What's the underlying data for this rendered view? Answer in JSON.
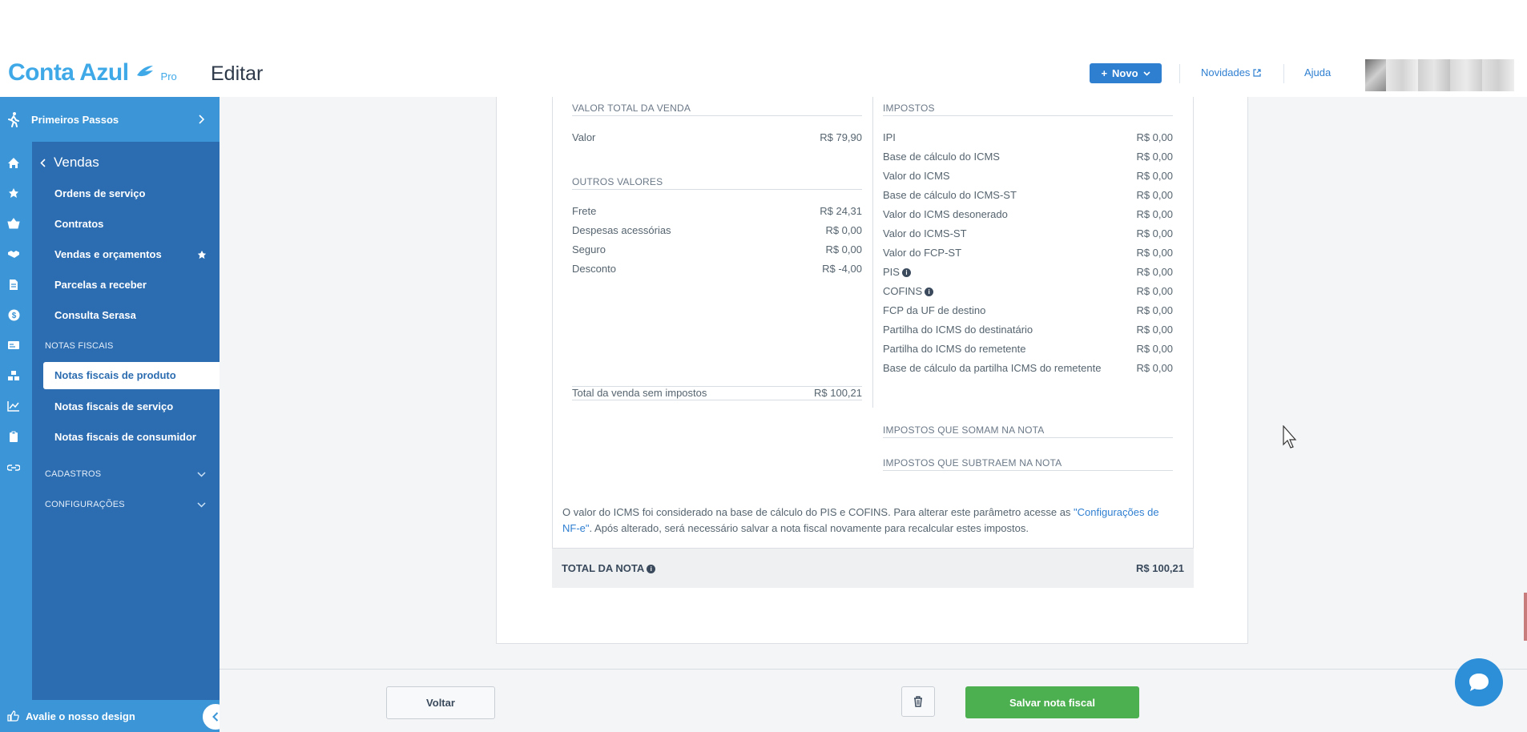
{
  "header": {
    "logo_text": "Conta Azul",
    "logo_pro": "Pro",
    "title": "Editar",
    "novo_label": "Novo",
    "links": [
      "Novidades",
      "Ajuda"
    ]
  },
  "sidebar": {
    "primeiros_passos": "Primeiros Passos",
    "section_title": "Vendas",
    "items": [
      {
        "label": "Ordens de serviço"
      },
      {
        "label": "Contratos"
      },
      {
        "label": "Vendas e orçamentos"
      },
      {
        "label": "Parcelas a receber"
      },
      {
        "label": "Consulta Serasa"
      }
    ],
    "notas_heading": "NOTAS FISCAIS",
    "notas_items": [
      {
        "label": "Notas fiscais de produto"
      },
      {
        "label": "Notas fiscais de serviço"
      },
      {
        "label": "Notas fiscais de consumidor"
      }
    ],
    "cadastros": "CADASTROS",
    "configuracoes": "CONFIGURAÇÕES",
    "footer": "Avalie o nosso design"
  },
  "summary": {
    "valor_total_title": "VALOR TOTAL DA VENDA",
    "valor_label": "Valor",
    "valor_value": "R$ 79,90",
    "outros_title": "OUTROS VALORES",
    "outros": [
      {
        "label": "Frete",
        "value": "R$ 24,31"
      },
      {
        "label": "Despesas acessórias",
        "value": "R$ 0,00"
      },
      {
        "label": "Seguro",
        "value": "R$ 0,00"
      },
      {
        "label": "Desconto",
        "value": "R$ -4,00"
      }
    ],
    "total_sem_label": "Total da venda sem impostos",
    "total_sem_value": "R$ 100,21",
    "impostos_title": "IMPOSTOS",
    "impostos": [
      {
        "label": "IPI",
        "value": "R$ 0,00"
      },
      {
        "label": "Base de cálculo do ICMS",
        "value": "R$ 0,00"
      },
      {
        "label": "Valor do ICMS",
        "value": "R$ 0,00"
      },
      {
        "label": "Base de cálculo do ICMS-ST",
        "value": "R$ 0,00"
      },
      {
        "label": "Valor do ICMS desonerado",
        "value": "R$ 0,00"
      },
      {
        "label": "Valor do ICMS-ST",
        "value": "R$ 0,00"
      },
      {
        "label": "Valor do FCP-ST",
        "value": "R$ 0,00"
      },
      {
        "label": "PIS",
        "value": "R$ 0,00"
      },
      {
        "label": "COFINS",
        "value": "R$ 0,00"
      },
      {
        "label": "FCP da UF de destino",
        "value": "R$ 0,00"
      },
      {
        "label": "Partilha do ICMS do destinatário",
        "value": "R$ 0,00"
      },
      {
        "label": "Partilha do ICMS do remetente",
        "value": "R$ 0,00"
      },
      {
        "label": "Base de cálculo da partilha ICMS do remetente",
        "value": "R$ 0,00"
      }
    ],
    "somam_title": "IMPOSTOS QUE SOMAM NA NOTA",
    "subtraem_title": "IMPOSTOS QUE SUBTRAEM NA NOTA",
    "note_pre": "O valor do ICMS foi considerado na base de cálculo do PIS e COFINS. Para alterar este parâmetro acesse as ",
    "note_link": "\"Configurações de NF-e\"",
    "note_post": ". Após alterado, será necessário salvar a nota fiscal novamente para recalcular estes impostos.",
    "total_nota_label": "TOTAL DA NOTA",
    "total_nota_value": "R$ 100,21"
  },
  "actions": {
    "voltar": "Voltar",
    "salvar": "Salvar nota fiscal"
  },
  "colors": {
    "brand": "#3fa9e8",
    "sidebar": "#2c6cb0",
    "primary": "#2f7fd1",
    "save": "#4caf50"
  }
}
